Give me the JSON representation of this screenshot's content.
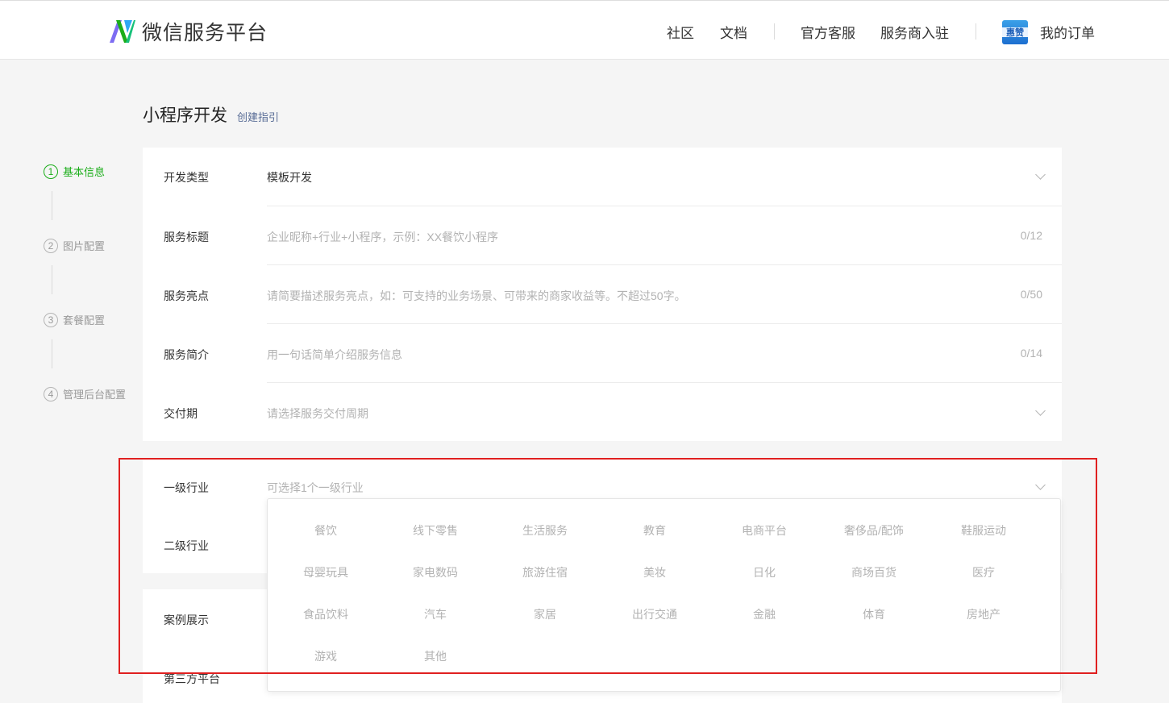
{
  "header": {
    "brand": "微信服务平台",
    "nav": {
      "community": "社区",
      "docs": "文档",
      "support": "官方客服",
      "join": "服务商入驻",
      "orders": "我的订单"
    },
    "avatar_text": "惠赞"
  },
  "page": {
    "title": "小程序开发",
    "guide_link": "创建指引"
  },
  "steps": [
    {
      "num": "1",
      "label": "基本信息",
      "active": true
    },
    {
      "num": "2",
      "label": "图片配置",
      "active": false
    },
    {
      "num": "3",
      "label": "套餐配置",
      "active": false
    },
    {
      "num": "4",
      "label": "管理后台配置",
      "active": false
    }
  ],
  "form": {
    "dev_type": {
      "label": "开发类型",
      "value": "模板开发"
    },
    "service_title": {
      "label": "服务标题",
      "placeholder": "企业昵称+行业+小程序，示例：XX餐饮小程序",
      "count": "0/12"
    },
    "service_highlight": {
      "label": "服务亮点",
      "placeholder": "请简要描述服务亮点，如：可支持的业务场景、可带来的商家收益等。不超过50字。",
      "count": "0/50"
    },
    "service_intro": {
      "label": "服务简介",
      "placeholder": "用一句话简单介绍服务信息",
      "count": "0/14"
    },
    "delivery": {
      "label": "交付期",
      "placeholder": "请选择服务交付周期"
    },
    "industry1": {
      "label": "一级行业",
      "placeholder": "可选择1个一级行业"
    },
    "industry2": {
      "label": "二级行业"
    },
    "cases": {
      "label": "案例展示"
    },
    "third_party": {
      "label": "第三方平台"
    }
  },
  "industries": [
    "餐饮",
    "线下零售",
    "生活服务",
    "教育",
    "电商平台",
    "奢侈品/配饰",
    "鞋服运动",
    "母婴玩具",
    "家电数码",
    "旅游住宿",
    "美妆",
    "日化",
    "商场百货",
    "医疗",
    "食品饮料",
    "汽车",
    "家居",
    "出行交通",
    "金融",
    "体育",
    "房地产",
    "游戏",
    "其他"
  ],
  "colors": {
    "accent": "#1aad19",
    "link": "#576b95",
    "highlight": "#e02020"
  }
}
